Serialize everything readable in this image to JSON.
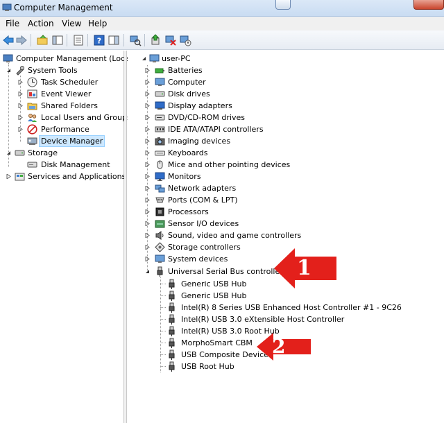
{
  "window": {
    "title": "Computer Management"
  },
  "menu": [
    "File",
    "Action",
    "View",
    "Help"
  ],
  "left_tree": {
    "root": "Computer Management (Local",
    "system_tools": "System Tools",
    "task_scheduler": "Task Scheduler",
    "event_viewer": "Event Viewer",
    "shared_folders": "Shared Folders",
    "local_users": "Local Users and Groups",
    "performance": "Performance",
    "device_manager": "Device Manager",
    "storage": "Storage",
    "disk_management": "Disk Management",
    "services": "Services and Applications"
  },
  "device_tree": {
    "root": "user-PC",
    "categories": [
      "Batteries",
      "Computer",
      "Disk drives",
      "Display adapters",
      "DVD/CD-ROM drives",
      "IDE ATA/ATAPI controllers",
      "Imaging devices",
      "Keyboards",
      "Mice and other pointing devices",
      "Monitors",
      "Network adapters",
      "Ports (COM & LPT)",
      "Processors",
      "Sensor I/O devices",
      "Sound, video and game controllers",
      "Storage controllers",
      "System devices"
    ],
    "usb": {
      "label": "Universal Serial Bus controllers",
      "children": [
        "Generic USB Hub",
        "Generic USB Hub",
        "Intel(R) 8 Series USB Enhanced Host Controller #1 - 9C26",
        "Intel(R) USB 3.0 eXtensible Host Controller",
        "Intel(R) USB 3.0 Root Hub",
        "MorphoSmart CBM",
        "USB Composite Device",
        "USB Root Hub"
      ]
    }
  },
  "annotations": [
    "1",
    "2"
  ],
  "colors": {
    "annotation": "#e3201b",
    "selection": "#cde8ff"
  }
}
